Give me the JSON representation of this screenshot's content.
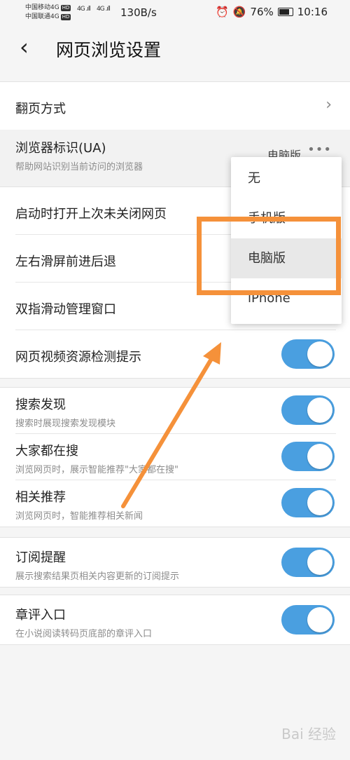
{
  "status_bar": {
    "carrier1": "中国移动4G",
    "carrier2": "中国联通4G",
    "hd": "HD",
    "sig1": "4G .ıll",
    "sig2": "4G .ıll",
    "speed": "130B/s",
    "battery": "76%",
    "time": "10:16"
  },
  "header": {
    "title": "网页浏览设置",
    "back_icon": "chevron-left-icon"
  },
  "settings": {
    "page_turn": "翻页方式",
    "ua_label": "浏览器标识(UA)",
    "ua_sub": "帮助网站识别当前访问的浏览器",
    "ua_value": "电脑版",
    "restore": "启动时打开上次未关闭网页",
    "swipe": "左右滑屏前进后退",
    "two_finger": "双指滑动管理窗口",
    "video_detect": "网页视频资源检测提示",
    "search_discover": "搜索发现",
    "search_discover_sub": "搜索时展现搜索发现模块",
    "everyone_search": "大家都在搜",
    "everyone_search_sub": "浏览网页时，展示智能推荐\"大家都在搜\"",
    "related": "相关推荐",
    "related_sub": "浏览网页时，智能推荐相关新闻",
    "subscribe": "订阅提醒",
    "subscribe_sub": "展示搜索结果页相关内容更新的订阅提示",
    "chapter": "章评入口",
    "chapter_sub": "在小说阅读转码页底部的章评入口"
  },
  "dropdown": {
    "options": [
      "无",
      "手机版",
      "电脑版",
      "iPhone"
    ],
    "selected": "电脑版"
  },
  "colors": {
    "toggle_on": "#4a9fe0",
    "annotation": "#f5913a"
  },
  "watermark": "Bai 经验"
}
